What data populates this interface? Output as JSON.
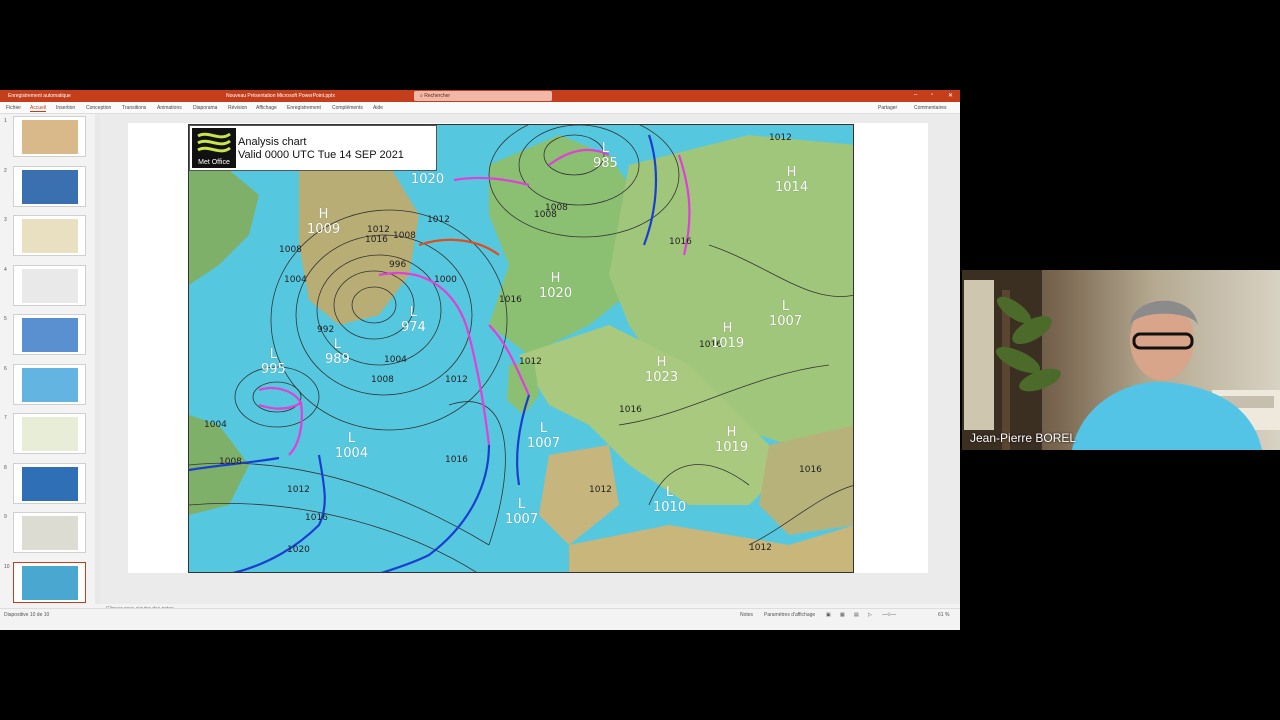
{
  "app": {
    "autosave_label": "Enregistrement automatique",
    "file_title": "Nouveau Présentation Microsoft PowerPoint.pptx",
    "search_placeholder": "Rechercher",
    "menu_tabs": [
      "Fichier",
      "Accueil",
      "Insertion",
      "Conception",
      "Transitions",
      "Animations",
      "Diaporama",
      "Révision",
      "Affichage",
      "Enregistrement",
      "Compléments",
      "Aide"
    ],
    "share_label": "Partager",
    "comments_label": "Commentaires"
  },
  "thumbnails": {
    "count": 10,
    "numbers": [
      "1",
      "2",
      "3",
      "4",
      "5",
      "6",
      "7",
      "8",
      "9",
      "10"
    ],
    "active_index": 9
  },
  "slide": {
    "chart_logo": "Met Office",
    "chart_title_line1": "Analysis chart",
    "chart_title_line2": "Valid 0000 UTC Tue 14 SEP 2021",
    "pressure_systems": [
      {
        "type": "L",
        "value": "985"
      },
      {
        "type": "H",
        "value": "1020"
      },
      {
        "type": "H",
        "value": "1014"
      },
      {
        "type": "H",
        "value": "1009"
      },
      {
        "type": "H",
        "value": "1020"
      },
      {
        "type": "L",
        "value": "974"
      },
      {
        "type": "L",
        "value": "989"
      },
      {
        "type": "L",
        "value": "995"
      },
      {
        "type": "H",
        "value": "1019"
      },
      {
        "type": "L",
        "value": "1007"
      },
      {
        "type": "H",
        "value": "1023"
      },
      {
        "type": "L",
        "value": "1004"
      },
      {
        "type": "L",
        "value": "1007"
      },
      {
        "type": "H",
        "value": "1019"
      },
      {
        "type": "L",
        "value": "1010"
      },
      {
        "type": "L",
        "value": "1007"
      }
    ],
    "isobar_labels": [
      "1012",
      "1008",
      "1016",
      "1012",
      "1008",
      "1004",
      "1000",
      "996",
      "992",
      "1004",
      "1008",
      "1012",
      "1016",
      "1008",
      "1004",
      "1008",
      "1012",
      "1016",
      "1020",
      "1016",
      "1012",
      "1012",
      "1016",
      "1016",
      "1012",
      "1016",
      "1012",
      "1008",
      "1016"
    ]
  },
  "notes": {
    "placeholder": "Cliquez pour ajouter des notes"
  },
  "status": {
    "slide_indicator": "Diapositive 10 de 10",
    "notes_label": "Notes",
    "display_settings": "Paramètres d'affichage",
    "zoom": "61 %"
  },
  "webcam": {
    "participant_name": "Jean-Pierre BOREL"
  },
  "colors": {
    "powerpoint_red": "#c43e1c",
    "sea": "#55c8e0",
    "land_green": "#8bbf72",
    "warm_front": "#e04c1c",
    "cold_front": "#1a3fcf",
    "occluded_front": "#e040d8"
  }
}
